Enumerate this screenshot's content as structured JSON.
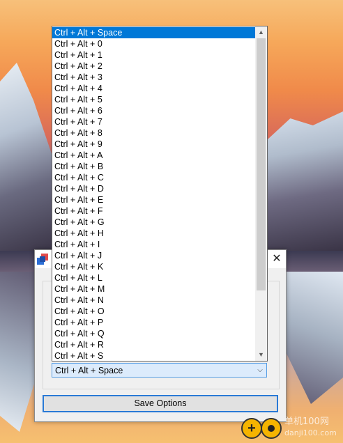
{
  "dialog": {
    "close_glyph": "✕",
    "combo": {
      "selected": "Ctrl + Alt + Space",
      "arrow": "⌵"
    },
    "save_label": "Save Options"
  },
  "dropdown": {
    "items": [
      "Ctrl + Alt + Space",
      "Ctrl + Alt + 0",
      "Ctrl + Alt + 1",
      "Ctrl + Alt + 2",
      "Ctrl + Alt + 3",
      "Ctrl + Alt + 4",
      "Ctrl + Alt + 5",
      "Ctrl + Alt + 6",
      "Ctrl + Alt + 7",
      "Ctrl + Alt + 8",
      "Ctrl + Alt + 9",
      "Ctrl + Alt + A",
      "Ctrl + Alt + B",
      "Ctrl + Alt + C",
      "Ctrl + Alt + D",
      "Ctrl + Alt + E",
      "Ctrl + Alt + F",
      "Ctrl + Alt + G",
      "Ctrl + Alt + H",
      "Ctrl + Alt + I",
      "Ctrl + Alt + J",
      "Ctrl + Alt + K",
      "Ctrl + Alt + L",
      "Ctrl + Alt + M",
      "Ctrl + Alt + N",
      "Ctrl + Alt + O",
      "Ctrl + Alt + P",
      "Ctrl + Alt + Q",
      "Ctrl + Alt + R",
      "Ctrl + Alt + S"
    ],
    "selected_index": 0,
    "scroll_up_glyph": "▲",
    "scroll_down_glyph": "▼"
  },
  "watermark": {
    "line1": "单机100网",
    "line2": "danji100.com"
  },
  "colors": {
    "selection": "#0078d7",
    "combo_focus": "#569de5",
    "button_focus": "#2a7ad6"
  },
  "icons": [
    "app-icon",
    "close-icon",
    "chevron-down-icon",
    "scroll-up-icon",
    "scroll-down-icon"
  ]
}
